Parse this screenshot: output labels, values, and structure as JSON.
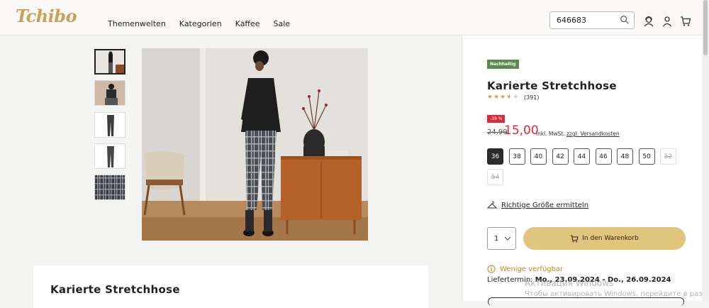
{
  "header": {
    "logo": "Tchibo",
    "nav": [
      "Themenwelten",
      "Kategorien",
      "Kaffee",
      "Sale"
    ],
    "search_value": "646683"
  },
  "gallery": {
    "thumb_count": 5
  },
  "product": {
    "badge": "Nachhaltig",
    "title": "Karierte Stretchhose",
    "rating": 3.5,
    "rating_max": 5,
    "reviews": "(391)",
    "discount": "-39 %",
    "old_price": "24,99",
    "price": "15,00",
    "tax_note": "inkl. MwSt.",
    "shipping_link": "zzgl. Versandkosten",
    "sizes": [
      {
        "label": "36",
        "state": "active"
      },
      {
        "label": "38",
        "state": "ok"
      },
      {
        "label": "40",
        "state": "ok"
      },
      {
        "label": "42",
        "state": "ok"
      },
      {
        "label": "44",
        "state": "ok"
      },
      {
        "label": "46",
        "state": "ok"
      },
      {
        "label": "48",
        "state": "ok"
      },
      {
        "label": "50",
        "state": "ok"
      },
      {
        "label": "52",
        "state": "na"
      },
      {
        "label": "54",
        "state": "na"
      }
    ],
    "size_help": "Richtige Größe ermitteln",
    "quantity": "1",
    "cart_label": "In den Warenkorb",
    "availability": "Wenige verfügbar",
    "delivery_label": "Liefertermin:",
    "delivery_dates": "Mo., 23.09.2024 - Do., 26.09.2024"
  },
  "description": {
    "title": "Karierte Stretchhose"
  },
  "overlay": {
    "line1": "Активация Windows",
    "line2": "Чтобы активировать Windows, перейдите в раздел"
  },
  "colors": {
    "accent": "#c9a25a",
    "sale": "#d9293b",
    "cart": "#e2c57c",
    "eco": "#5a8a4f"
  }
}
